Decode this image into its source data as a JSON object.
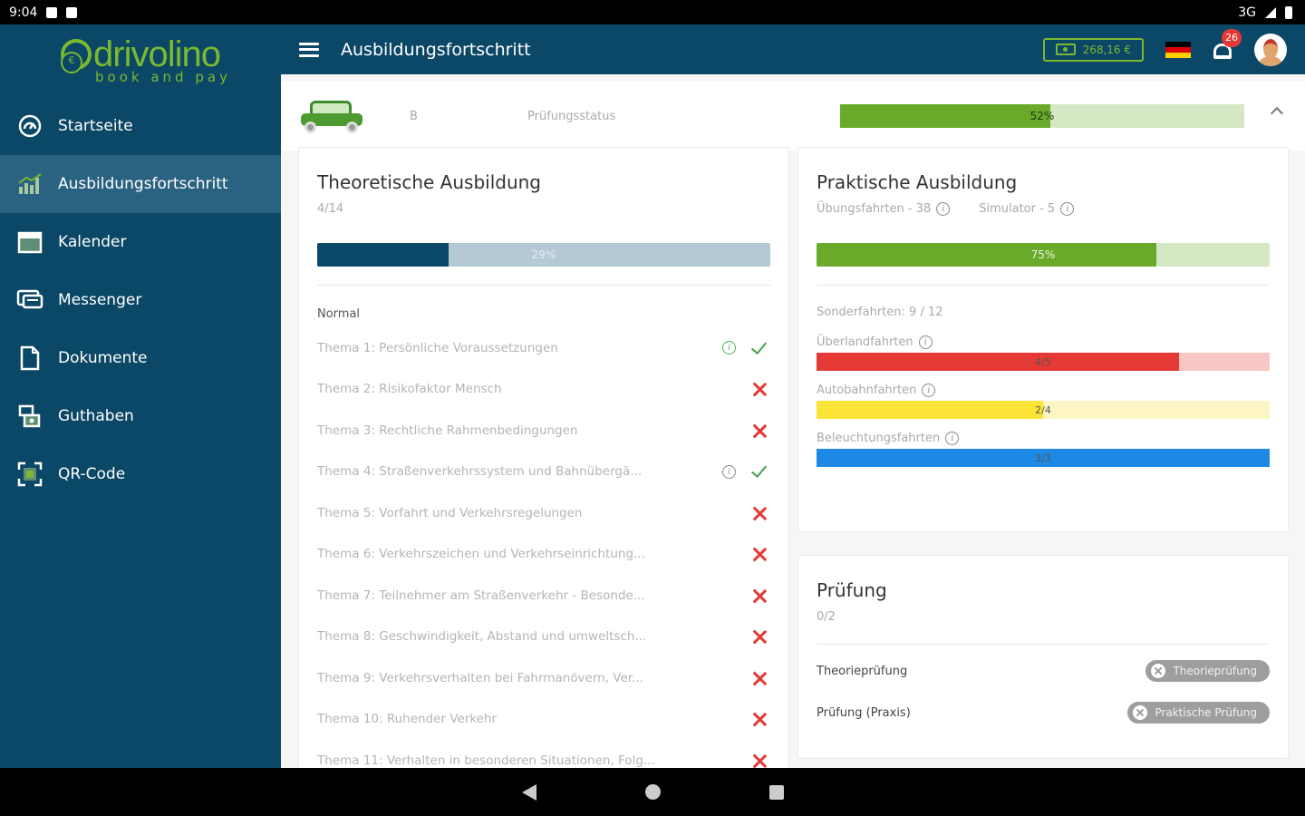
{
  "status_bar": {
    "time": "9:04",
    "network": "3G"
  },
  "sidebar": {
    "logo_text": "drivolino",
    "logo_sub": "book and pay",
    "items": [
      {
        "label": "Startseite",
        "icon": "speedometer-icon",
        "active": false
      },
      {
        "label": "Ausbildungsfortschritt",
        "icon": "chart-icon",
        "active": true
      },
      {
        "label": "Kalender",
        "icon": "calendar-icon",
        "active": false
      },
      {
        "label": "Messenger",
        "icon": "chat-icon",
        "active": false
      },
      {
        "label": "Dokumente",
        "icon": "document-icon",
        "active": false
      },
      {
        "label": "Guthaben",
        "icon": "wallet-icon",
        "active": false
      },
      {
        "label": "QR-Code",
        "icon": "qr-icon",
        "active": false
      }
    ]
  },
  "appbar": {
    "title": "Ausbildungsfortschritt",
    "credit": "268,16 €",
    "notification_count": "26"
  },
  "summary": {
    "category": "B",
    "label": "Prüfungsstatus",
    "progress_percent": 52,
    "progress_text": "52%"
  },
  "theory": {
    "title": "Theoretische Ausbildung",
    "count": "4/14",
    "progress_percent": 29,
    "progress_text": "29%",
    "section_label": "Normal",
    "topics": [
      {
        "text": "Thema 1: Persönliche Voraussetzungen",
        "done": true,
        "info": true,
        "info_green": true
      },
      {
        "text": "Thema 2: Risikofaktor Mensch",
        "done": false,
        "info": false
      },
      {
        "text": "Thema 3: Rechtliche Rahmenbedingungen",
        "done": false,
        "info": false
      },
      {
        "text": "Thema 4: Straßenverkehrssystem und Bahnübergä...",
        "done": true,
        "info": true,
        "info_green": false
      },
      {
        "text": "Thema 5: Vorfahrt und Verkehrsregelungen",
        "done": false,
        "info": false
      },
      {
        "text": "Thema 6: Verkehrszeichen und Verkehrseinrichtung...",
        "done": false,
        "info": false
      },
      {
        "text": "Thema 7: Teilnehmer am Straßenverkehr - Besonde...",
        "done": false,
        "info": false
      },
      {
        "text": "Thema 8: Geschwindigkeit, Abstand und umweltsch...",
        "done": false,
        "info": false
      },
      {
        "text": "Thema 9: Verkehrsverhalten bei Fahrmanövern, Ver...",
        "done": false,
        "info": false
      },
      {
        "text": "Thema 10: Ruhender Verkehr",
        "done": false,
        "info": false
      },
      {
        "text": "Thema 11: Verhalten in besonderen Situationen, Folg...",
        "done": false,
        "info": false
      }
    ]
  },
  "practice": {
    "title": "Praktische Ausbildung",
    "lessons": "Übungsfahrten - 38",
    "simulator": "Simulator - 5",
    "progress_percent": 75,
    "progress_text": "75%",
    "special_label": "Sonderfahrten: 9 / 12",
    "special": [
      {
        "label": "Überlandfahrten",
        "text": "4/5",
        "percent": 80,
        "fill": "#e53935",
        "track": "#f8c6c4"
      },
      {
        "label": "Autobahnfahrten",
        "text": "2/4",
        "percent": 50,
        "fill": "#fbe337",
        "track": "#fdf5c4"
      },
      {
        "label": "Beleuchtungsfahrten",
        "text": "3/3",
        "percent": 100,
        "fill": "#1e88e5",
        "track": "#c6e1f9"
      }
    ]
  },
  "exam": {
    "title": "Prüfung",
    "count": "0/2",
    "rows": [
      {
        "label": "Theorieprüfung",
        "chip": "Theorieprüfung"
      },
      {
        "label": "Prüfung (Praxis)",
        "chip": "Praktische Prüfung"
      }
    ]
  },
  "colors": {
    "brand": "#0b4766",
    "accent": "#7cb82f",
    "theory_fill": "#0b4766",
    "theory_track": "#b5c9d4",
    "practice_fill": "#6aaa2a",
    "practice_track": "#d5e8c4"
  }
}
